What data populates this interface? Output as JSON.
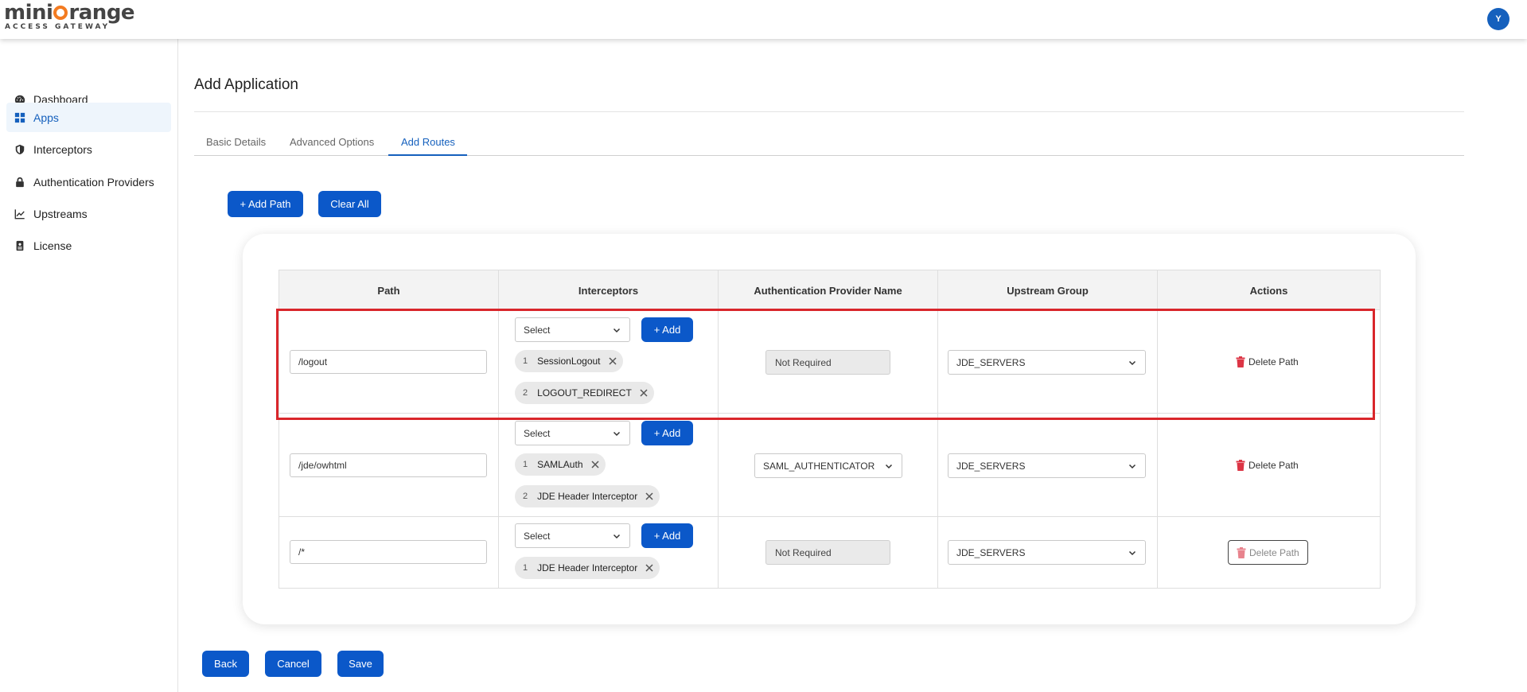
{
  "brand": {
    "logo_part1": "mini",
    "logo_part2": "range",
    "logo_sub": "ACCESS GATEWAY",
    "avatar_initial": "Y",
    "accent": "#f37b21",
    "primary": "#0b58c9"
  },
  "sidebar": {
    "items": [
      {
        "label": "Dashboard",
        "icon": "dashboard-icon",
        "active": false
      },
      {
        "label": "Apps",
        "icon": "apps-grid-icon",
        "active": true
      },
      {
        "label": "Interceptors",
        "icon": "shield-icon",
        "active": false
      },
      {
        "label": "Authentication Providers",
        "icon": "lock-icon",
        "active": false
      },
      {
        "label": "Upstreams",
        "icon": "chart-line-icon",
        "active": false
      },
      {
        "label": "License",
        "icon": "id-badge-icon",
        "active": false
      }
    ]
  },
  "page": {
    "title": "Add Application"
  },
  "tabs": [
    {
      "label": "Basic Details",
      "active": false
    },
    {
      "label": "Advanced Options",
      "active": false
    },
    {
      "label": "Add Routes",
      "active": true
    }
  ],
  "toolbar": {
    "add_path_label": "+ Add Path",
    "clear_all_label": "Clear All"
  },
  "table": {
    "headers": [
      "Path",
      "Interceptors",
      "Authentication Provider Name",
      "Upstream Group",
      "Actions"
    ],
    "rows": [
      {
        "path": "/logout",
        "interceptor_select": "Select",
        "add_label": "+ Add",
        "interceptors": [
          {
            "num": "1",
            "name": "SessionLogout"
          },
          {
            "num": "2",
            "name": "LOGOUT_REDIRECT"
          }
        ],
        "auth_provider": "Not Required",
        "auth_is_select": false,
        "upstream": "JDE_SERVERS",
        "delete_label": "Delete Path"
      },
      {
        "path": "/jde/owhtml",
        "interceptor_select": "Select",
        "add_label": "+ Add",
        "interceptors": [
          {
            "num": "1",
            "name": "SAMLAuth"
          },
          {
            "num": "2",
            "name": "JDE Header Interceptor"
          }
        ],
        "auth_provider": "SAML_AUTHENTICATOR",
        "auth_is_select": true,
        "upstream": "JDE_SERVERS",
        "delete_label": "Delete Path"
      },
      {
        "path": "/*",
        "interceptor_select": "Select",
        "add_label": "+ Add",
        "interceptors": [
          {
            "num": "1",
            "name": "JDE Header Interceptor"
          }
        ],
        "auth_provider": "Not Required",
        "auth_is_select": false,
        "upstream": "JDE_SERVERS",
        "delete_label": "Delete Path"
      }
    ]
  },
  "footer": {
    "back_label": "Back",
    "cancel_label": "Cancel",
    "save_label": "Save"
  }
}
